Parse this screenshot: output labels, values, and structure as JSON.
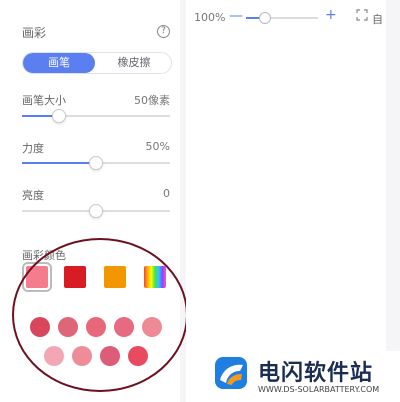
{
  "panel": {
    "title": "画彩",
    "help_icon": "?",
    "tabs": [
      {
        "label": "画笔",
        "active": true
      },
      {
        "label": "橡皮擦",
        "active": false
      }
    ],
    "brush_size": {
      "label": "画笔大小",
      "value_text": "50像素",
      "level": 0.25
    },
    "strength": {
      "label": "力度",
      "value_text": "50%",
      "level": 0.5
    },
    "brightness": {
      "label": "亮度",
      "value_text": "0",
      "level": 0.5
    },
    "color_section": {
      "title": "画彩颜色",
      "swatches": [
        {
          "name": "pink",
          "color": "#f47c8c",
          "selected": true
        },
        {
          "name": "red",
          "color": "#d91c24",
          "selected": false
        },
        {
          "name": "orange",
          "color": "#f39700",
          "selected": false
        },
        {
          "name": "rainbow",
          "color": "multicolor",
          "selected": false
        }
      ],
      "dots_row1": [
        "#d9475c",
        "#dd6677",
        "#e8687a",
        "#e66a80",
        "#ee8a96"
      ],
      "dots_row2": [
        "#f3a7b5",
        "#ee8c98",
        "#dd5c78",
        "#e94a60"
      ]
    }
  },
  "toolbar": {
    "zoom_text": "100%",
    "minus": "—",
    "plus": "+",
    "zoom_level": 0.25,
    "fit_label": "自",
    "fit_icon": "fit-screen-icon"
  },
  "watermark": {
    "title": "电闪软件站",
    "url": "WWW.DS-SOLARBATTERY.COM",
    "logo_icon": "logo-mark-icon"
  },
  "colors": {
    "accent": "#5b7ff1",
    "annotation_circle": "#6e1020"
  }
}
